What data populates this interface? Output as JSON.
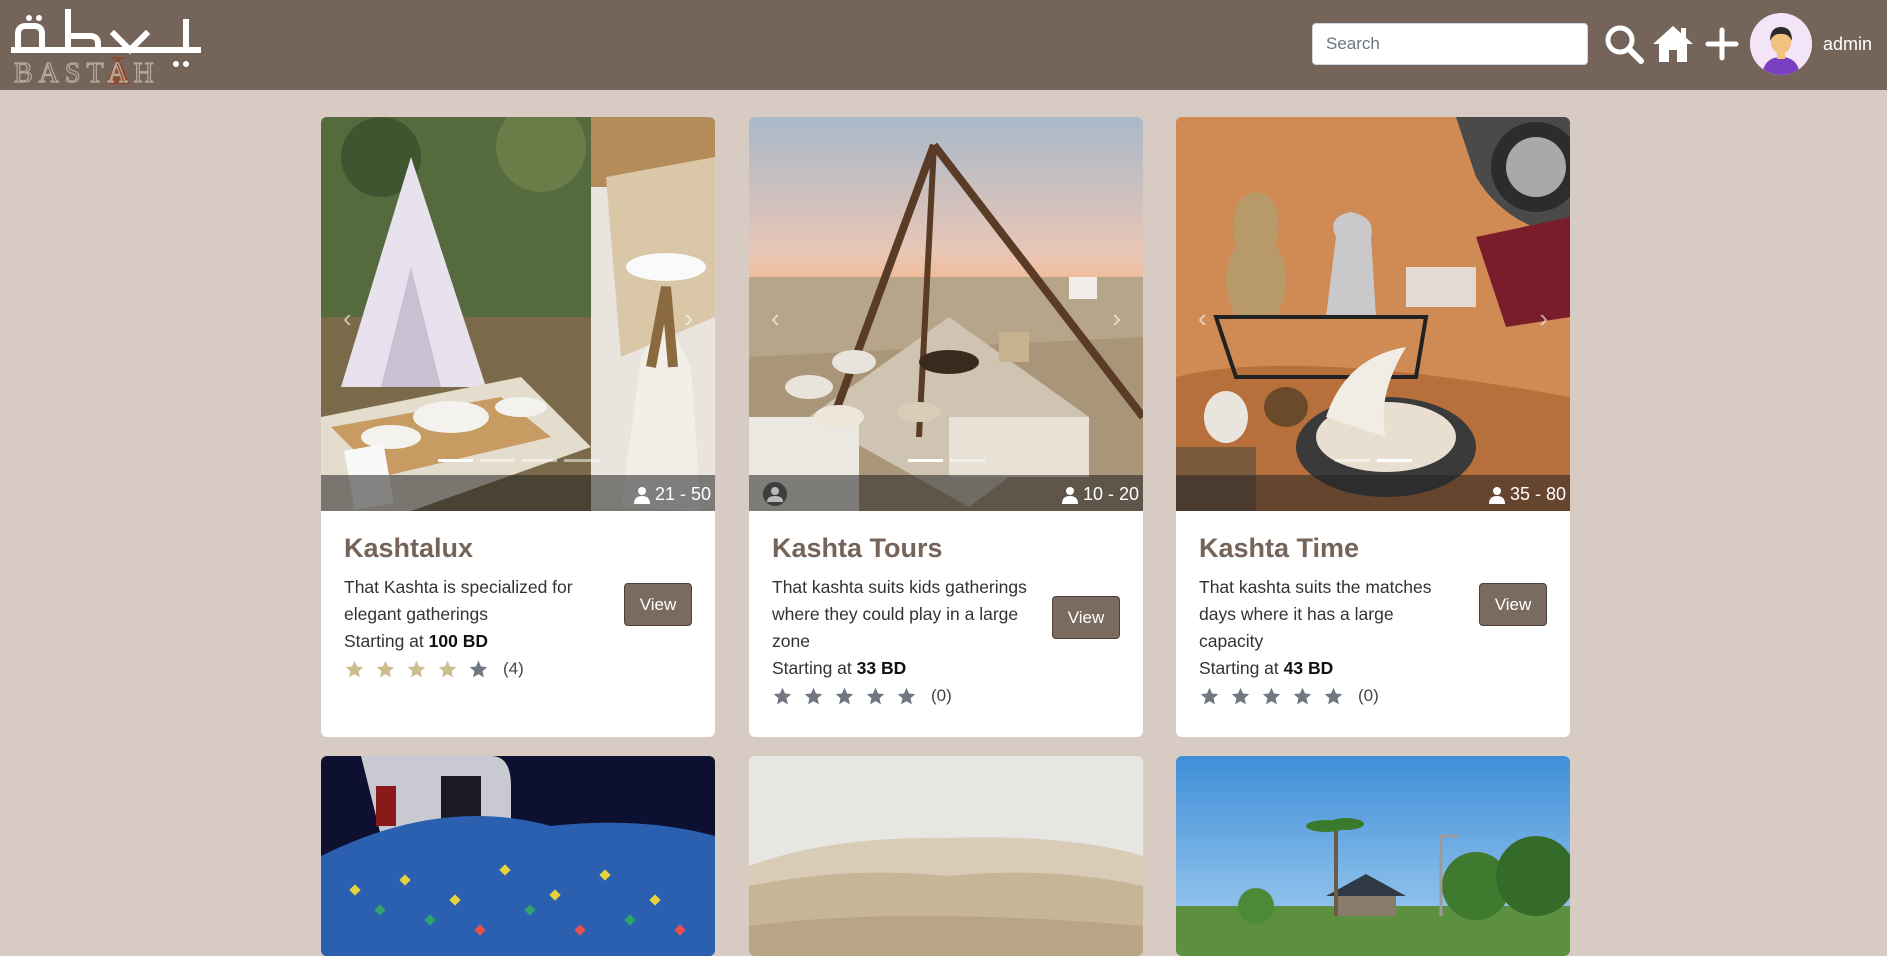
{
  "brand": {
    "logo_arabic": "بسطة",
    "logo_latin": "BASTAH"
  },
  "nav": {
    "search_placeholder": "Search",
    "username": "admin",
    "icons": [
      "search-icon",
      "home-icon",
      "plus-icon",
      "avatar"
    ]
  },
  "colors": {
    "navbar": "#756459",
    "page_background": "#d8cbc3",
    "title": "#756459",
    "button": "#7b6a60",
    "star_filled": "#cbbd8e",
    "star_empty": "#707780"
  },
  "cards": [
    {
      "title": "Kashtalux",
      "description": "That Kashta is specialized for elegant gatherings",
      "price_prefix": "Starting at",
      "price": "100 BD",
      "capacity": "21 - 50",
      "rating_stars": 4,
      "rating_count": "(4)",
      "view_label": "View",
      "slides": 4,
      "active_slide": 0
    },
    {
      "title": "Kashta Tours",
      "description": "That kashta suits kids gatherings where they could play in a large zone",
      "price_prefix": "Starting at",
      "price": "33 BD",
      "capacity": "10 - 20",
      "rating_stars": 0,
      "rating_count": "(0)",
      "view_label": "View",
      "slides": 2,
      "active_slide": 0
    },
    {
      "title": "Kashta Time",
      "description": "That kashta suits the matches days where it has a large capacity",
      "price_prefix": "Starting at",
      "price": "43 BD",
      "capacity": "35 - 80",
      "rating_stars": 0,
      "rating_count": "(0)",
      "view_label": "View",
      "slides": 2,
      "active_slide": 1
    }
  ]
}
